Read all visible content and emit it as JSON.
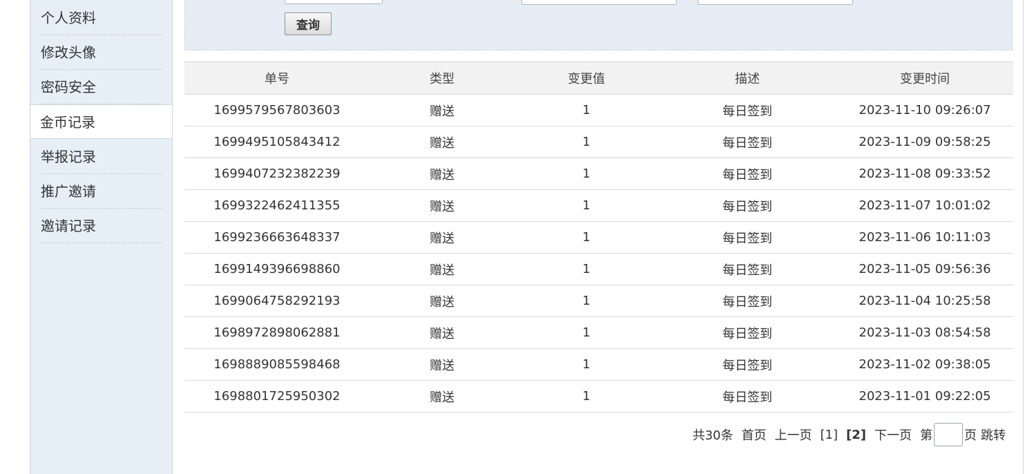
{
  "sidebar": {
    "items": [
      {
        "label": "个人资料",
        "active": false
      },
      {
        "label": "修改头像",
        "active": false
      },
      {
        "label": "密码安全",
        "active": false
      },
      {
        "label": "金币记录",
        "active": true
      },
      {
        "label": "举报记录",
        "active": false
      },
      {
        "label": "推广邀请",
        "active": false
      },
      {
        "label": "邀请记录",
        "active": false
      }
    ]
  },
  "search": {
    "query_label": "查询"
  },
  "table": {
    "headers": [
      "单号",
      "类型",
      "变更值",
      "描述",
      "变更时间"
    ],
    "rows": [
      [
        "1699579567803603",
        "赠送",
        "1",
        "每日签到",
        "2023-11-10 09:26:07"
      ],
      [
        "1699495105843412",
        "赠送",
        "1",
        "每日签到",
        "2023-11-09 09:58:25"
      ],
      [
        "1699407232382239",
        "赠送",
        "1",
        "每日签到",
        "2023-11-08 09:33:52"
      ],
      [
        "1699322462411355",
        "赠送",
        "1",
        "每日签到",
        "2023-11-07 10:01:02"
      ],
      [
        "1699236663648337",
        "赠送",
        "1",
        "每日签到",
        "2023-11-06 10:11:03"
      ],
      [
        "1699149396698860",
        "赠送",
        "1",
        "每日签到",
        "2023-11-05 09:56:36"
      ],
      [
        "1699064758292193",
        "赠送",
        "1",
        "每日签到",
        "2023-11-04 10:25:58"
      ],
      [
        "1698972898062881",
        "赠送",
        "1",
        "每日签到",
        "2023-11-03 08:54:58"
      ],
      [
        "1698889085598468",
        "赠送",
        "1",
        "每日签到",
        "2023-11-02 09:38:05"
      ],
      [
        "1698801725950302",
        "赠送",
        "1",
        "每日签到",
        "2023-11-01 09:22:05"
      ]
    ]
  },
  "pager": {
    "total": "共30条",
    "first": "首页",
    "prev": "上一页",
    "page1": "[1]",
    "page2": "[2]",
    "next": "下一页",
    "goto_prefix": "第",
    "goto_value": "",
    "goto_suffix": "页",
    "jump": "跳转"
  },
  "colors": {
    "sidebar_bg": "#e6eef6",
    "panel_bg": "#e6edf5",
    "header_bg": "#f2f2f2"
  }
}
